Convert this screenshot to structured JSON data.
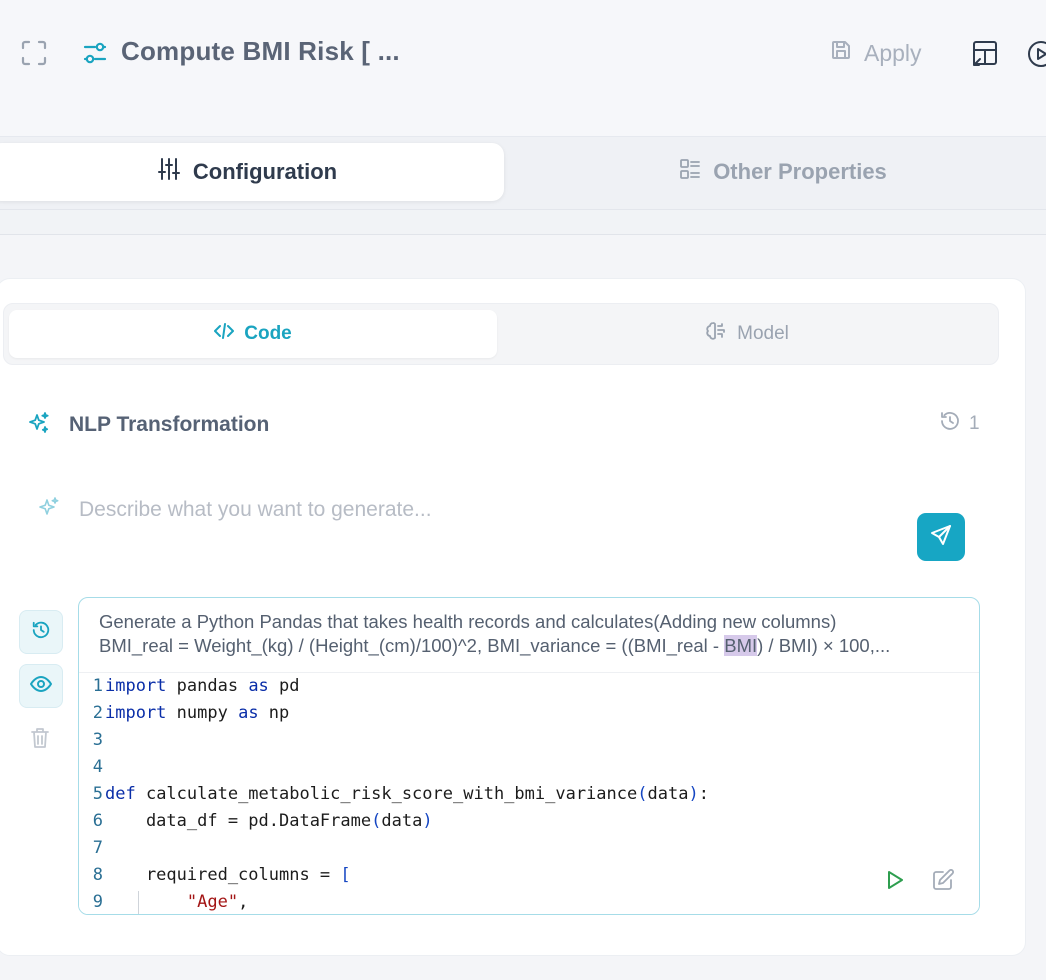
{
  "header": {
    "title": "Compute BMI Risk [ ...",
    "apply_label": "Apply",
    "icons": [
      "expand-icon",
      "sliders-icon",
      "save-icon",
      "layout-icon",
      "play-circle-icon"
    ]
  },
  "tabs": {
    "configuration_label": "Configuration",
    "other_properties_label": "Other Properties"
  },
  "segment": {
    "code_label": "Code",
    "model_label": "Model"
  },
  "nlp": {
    "title": "NLP Transformation",
    "history_count": "1",
    "prompt_placeholder": "Describe what you want to generate..."
  },
  "entry": {
    "prompt_line1": "Generate a Python Pandas that takes health records and calculates(Adding new columns)",
    "prompt_line2_before": "BMI_real = Weight_(kg) / (Height_(cm)/100)^2, BMI_variance = ((BMI_real - ",
    "prompt_line2_highlight": "BMI",
    "prompt_line2_after": ") / BMI) × 100,..."
  },
  "code": {
    "lines": [
      {
        "num": "1",
        "kw": "import",
        "a": " pandas ",
        "kw2": "as",
        "b": " pd"
      },
      {
        "num": "2",
        "kw": "import",
        "a": " numpy ",
        "kw2": "as",
        "b": " np"
      },
      {
        "num": "3"
      },
      {
        "num": "4"
      },
      {
        "num": "5",
        "kw": "def",
        "a": " calculate_metabolic_risk_score_with_bmi_variance",
        "p1": "(",
        "b": "data",
        "p2": ")",
        "c": ":"
      },
      {
        "num": "6",
        "a": "    data_df = pd.DataFrame",
        "p1": "(",
        "b": "data",
        "p2": ")"
      },
      {
        "num": "7"
      },
      {
        "num": "8",
        "a": "    required_columns = ",
        "p1": "["
      },
      {
        "num": "9",
        "a": "        ",
        "s": "\"Age\"",
        "b": ","
      }
    ]
  },
  "colors": {
    "accent": "#17a6c4",
    "background": "#f4f5f8"
  }
}
